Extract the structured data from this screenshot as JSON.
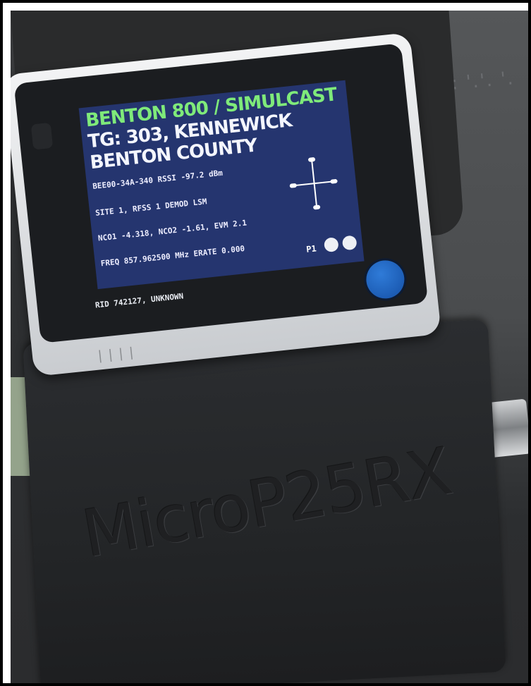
{
  "screen": {
    "title_line1": "BENTON 800 / SIMULCAST",
    "title_line2": "TG: 303, KENNEWICK",
    "title_line3": "BENTON COUNTY",
    "line_sysid": "BEE00-34A-340  RSSI -97.2 dBm",
    "line_site": "SITE 1, RFSS 1  DEMOD LSM",
    "line_nco": "NCO1 -4.318, NCO2 -1.61, EVM 2.1",
    "line_freq": "FREQ 857.962500 MHz  ERATE 0.000",
    "phase_label": "P1",
    "rid_line": "RID 742127, UNKNOWN"
  },
  "case_label": "MicroP25RX",
  "colors": {
    "lcd_background": "#25356f",
    "title_green": "#7fea7a",
    "button_blue": "#1e64c0"
  },
  "icons": {
    "constellation": "constellation-plot-icon",
    "status_leds": "status-led-icon",
    "button": "round-button-icon"
  }
}
